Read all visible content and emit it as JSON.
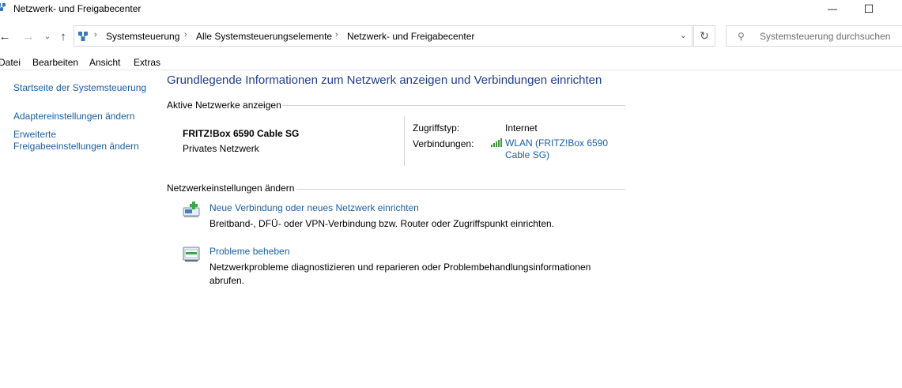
{
  "window": {
    "title": "Netzwerk- und Freigabecenter",
    "minimize_glyph": "—",
    "maximize_glyph": "☐"
  },
  "address": {
    "crumbs": [
      "Systemsteuerung",
      "Alle Systemsteuerungselemente",
      "Netzwerk- und Freigabecenter"
    ]
  },
  "search": {
    "placeholder": "Systemsteuerung durchsuchen"
  },
  "menu": [
    "Datei",
    "Bearbeiten",
    "Ansicht",
    "Extras"
  ],
  "sidebar": {
    "links": [
      "Startseite der Systemsteuerung",
      "Adaptereinstellungen ändern",
      "Erweiterte Freigabeeinstellungen ändern"
    ]
  },
  "main": {
    "heading": "Grundlegende Informationen zum Netzwerk anzeigen und Verbindungen einrichten",
    "active_section": "Aktive Netzwerke anzeigen",
    "network": {
      "name": "FRITZ!Box 6590 Cable SG",
      "type": "Privates Netzwerk",
      "access_label": "Zugriffstyp:",
      "access_value": "Internet",
      "connections_label": "Verbindungen:",
      "connection_link": "WLAN (FRITZ!Box 6590 Cable SG)"
    },
    "settings_section": "Netzwerkeinstellungen ändern",
    "tasks": [
      {
        "link": "Neue Verbindung oder neues Netzwerk einrichten",
        "desc": "Breitband-, DFÜ- oder VPN-Verbindung bzw. Router oder Zugriffspunkt einrichten.",
        "icon": "new-connection-icon"
      },
      {
        "link": "Probleme beheben",
        "desc": "Netzwerkprobleme diagnostizieren und reparieren oder Problembehandlungsinformationen abrufen.",
        "icon": "troubleshoot-icon"
      }
    ]
  },
  "colors": {
    "link": "#1a5fa6",
    "heading": "#1e3d8f",
    "wifi": "#3c9a3c"
  }
}
